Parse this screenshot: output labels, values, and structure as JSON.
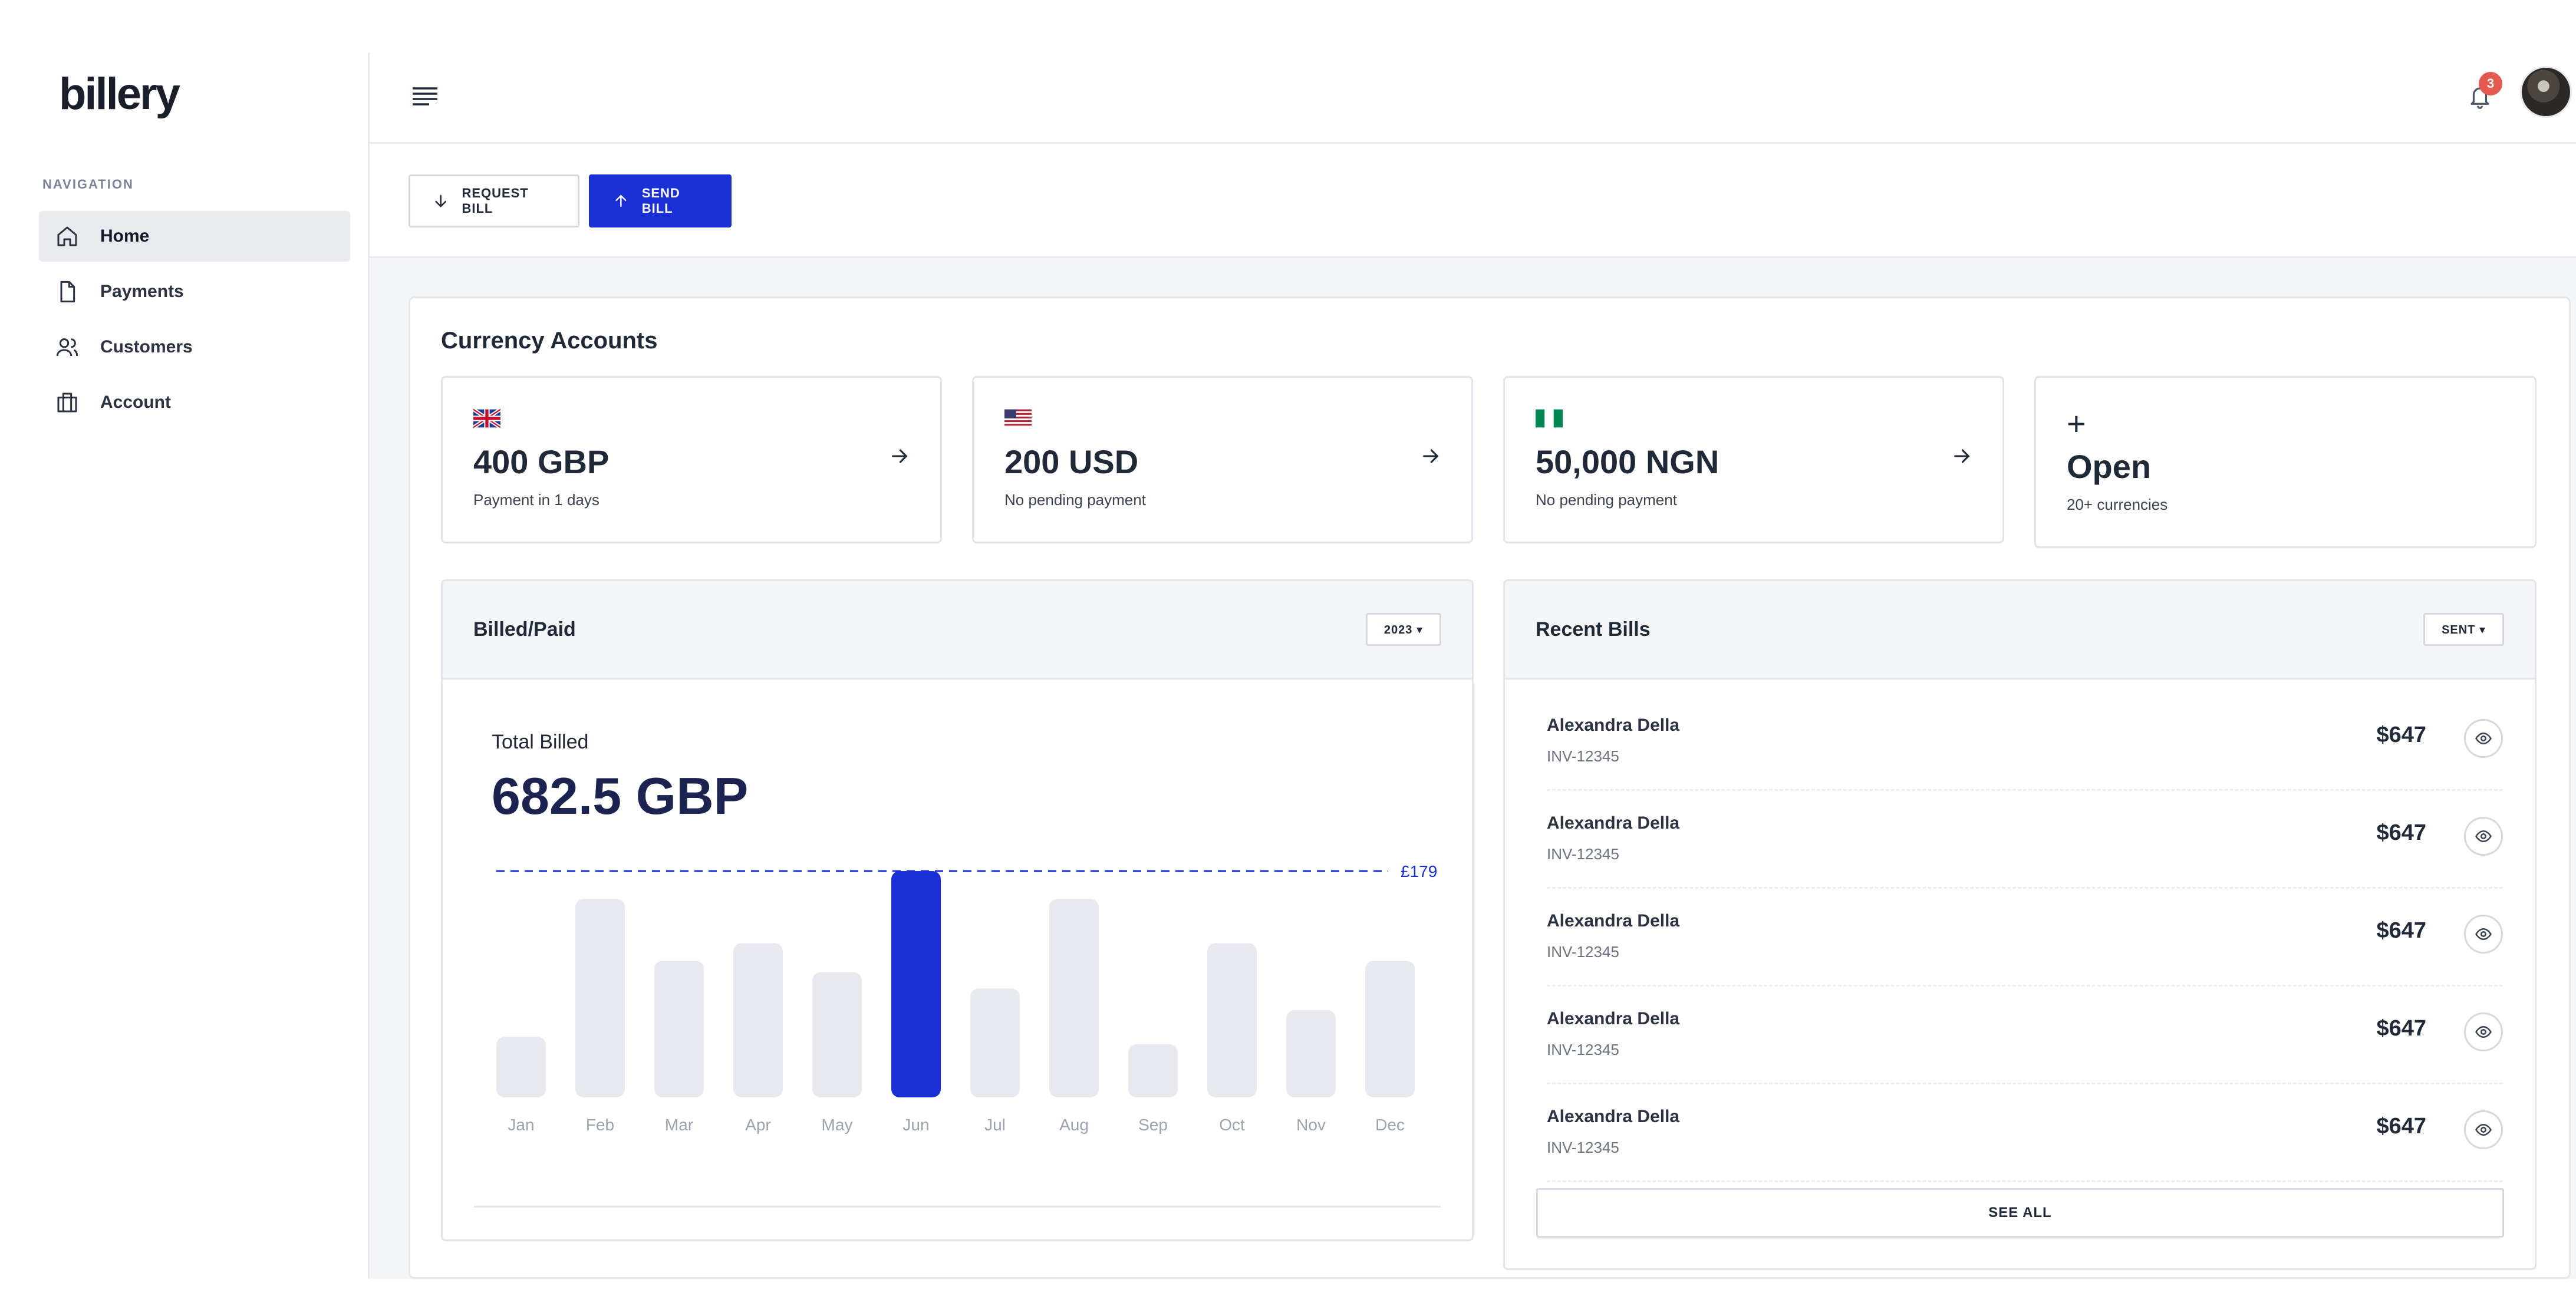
{
  "app": {
    "logo": "billery"
  },
  "sidebar": {
    "heading": "NAVIGATION",
    "items": [
      {
        "label": "Home",
        "icon": "home-icon",
        "active": true
      },
      {
        "label": "Payments",
        "icon": "file-icon",
        "active": false
      },
      {
        "label": "Customers",
        "icon": "users-icon",
        "active": false
      },
      {
        "label": "Account",
        "icon": "briefcase-icon",
        "active": false
      }
    ]
  },
  "topbar": {
    "notification_count": "3"
  },
  "actions": {
    "request_label": "REQUEST BILL",
    "send_label": "SEND BILL"
  },
  "currency": {
    "title": "Currency Accounts",
    "accounts": [
      {
        "flag": "gb-flag",
        "amount": "400 GBP",
        "sub": "Payment in 1 days"
      },
      {
        "flag": "us-flag",
        "amount": "200 USD",
        "sub": "No pending payment"
      },
      {
        "flag": "ng-flag",
        "amount": "50,000 NGN",
        "sub": "No pending payment"
      }
    ],
    "open": {
      "label": "Open",
      "sub": "20+ currencies"
    }
  },
  "billed": {
    "title": "Billed/Paid",
    "year_filter": "2023 ▾",
    "total_label": "Total Billed",
    "total_value": "682.5 GBP"
  },
  "chart_data": {
    "type": "bar",
    "categories": [
      "Jan",
      "Feb",
      "Mar",
      "Apr",
      "May",
      "Jun",
      "Jul",
      "Aug",
      "Sep",
      "Oct",
      "Nov",
      "Dec"
    ],
    "values": [
      48,
      157,
      108,
      122,
      99,
      179,
      86,
      157,
      42,
      122,
      69,
      108
    ],
    "highlight_index": 5,
    "reference_line": {
      "value": 179,
      "label": "£179"
    },
    "ylim": [
      0,
      179
    ],
    "colors": {
      "bar": "#e8e8ef",
      "highlight": "#1a2fd4",
      "reference": "#1a2fd4",
      "tick": "#9ca3af"
    }
  },
  "recent": {
    "title": "Recent Bills",
    "filter": "SENT ▾",
    "bills": [
      {
        "name": "Alexandra Della",
        "invoice": "INV-12345",
        "amount": "$647"
      },
      {
        "name": "Alexandra Della",
        "invoice": "INV-12345",
        "amount": "$647"
      },
      {
        "name": "Alexandra Della",
        "invoice": "INV-12345",
        "amount": "$647"
      },
      {
        "name": "Alexandra Della",
        "invoice": "INV-12345",
        "amount": "$647"
      },
      {
        "name": "Alexandra Della",
        "invoice": "INV-12345",
        "amount": "$647"
      }
    ],
    "see_all": "SEE ALL"
  }
}
